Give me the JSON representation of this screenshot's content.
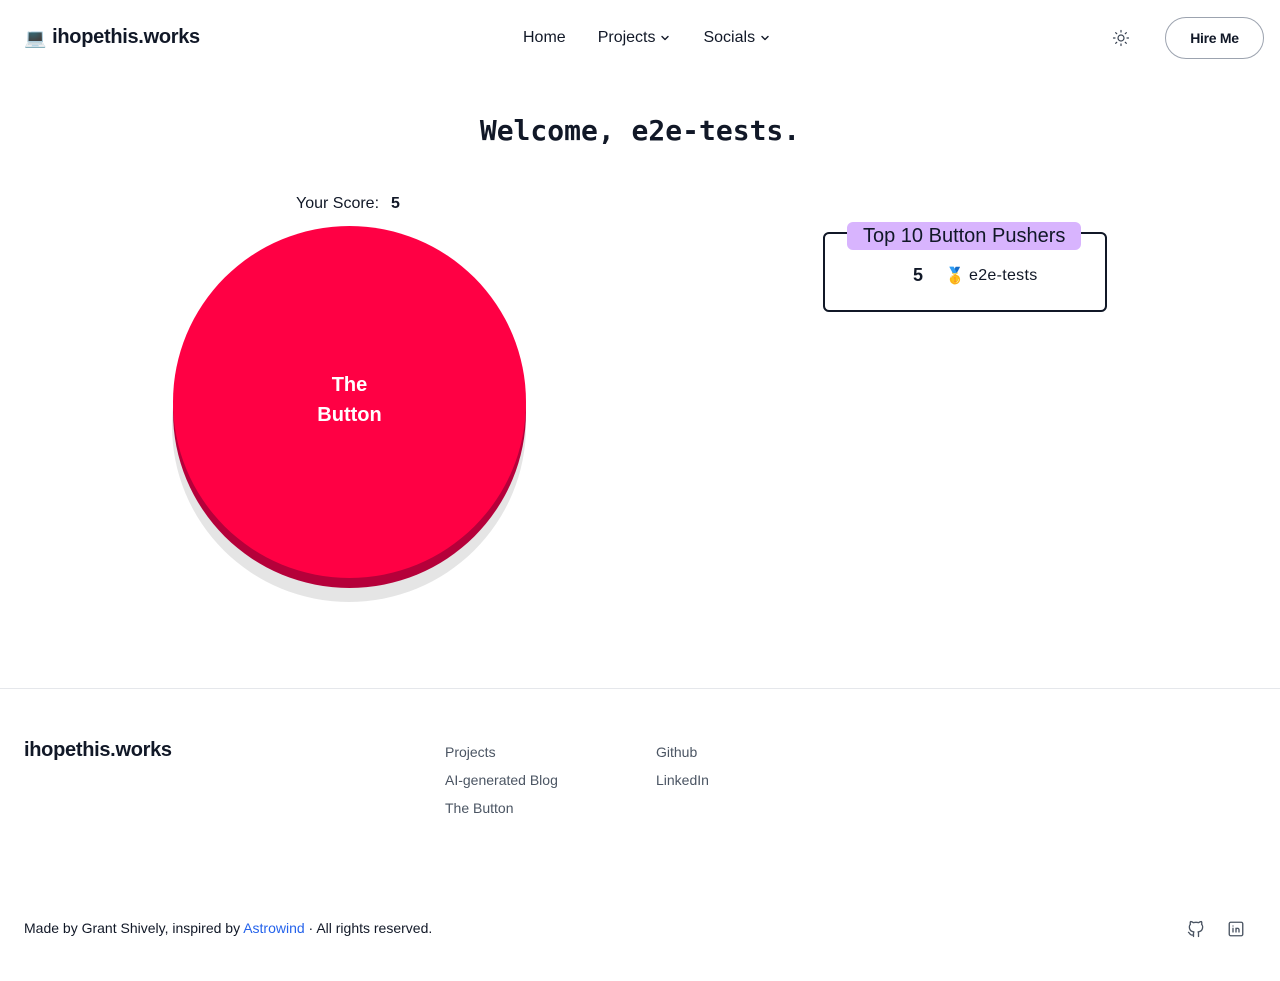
{
  "header": {
    "logo_icon": "💻",
    "logo_text": "ihopethis.works",
    "nav": {
      "home": "Home",
      "projects": "Projects",
      "socials": "Socials"
    },
    "theme_icon": "sun-icon",
    "hire_label": "Hire Me"
  },
  "main": {
    "welcome": "Welcome, e2e-tests.",
    "score_label": "Your Score:",
    "score_value": "5",
    "button_line1": "The",
    "button_line2": "Button",
    "button_color": "#ff0044",
    "leaderboard": {
      "title": "Top 10 Button Pushers",
      "title_bg": "#d8b4fe",
      "entries": [
        {
          "score": "5",
          "medal": "🥇",
          "name": "e2e-tests"
        }
      ]
    }
  },
  "footer": {
    "brand": "ihopethis.works",
    "col1": [
      "Projects",
      "AI-generated Blog",
      "The Button"
    ],
    "col2": [
      "Github",
      "LinkedIn"
    ],
    "copy_prefix": "Made by Grant Shively, inspired by ",
    "copy_link": "Astrowind",
    "copy_suffix": " · All rights reserved.",
    "link_color": "#2563eb"
  }
}
